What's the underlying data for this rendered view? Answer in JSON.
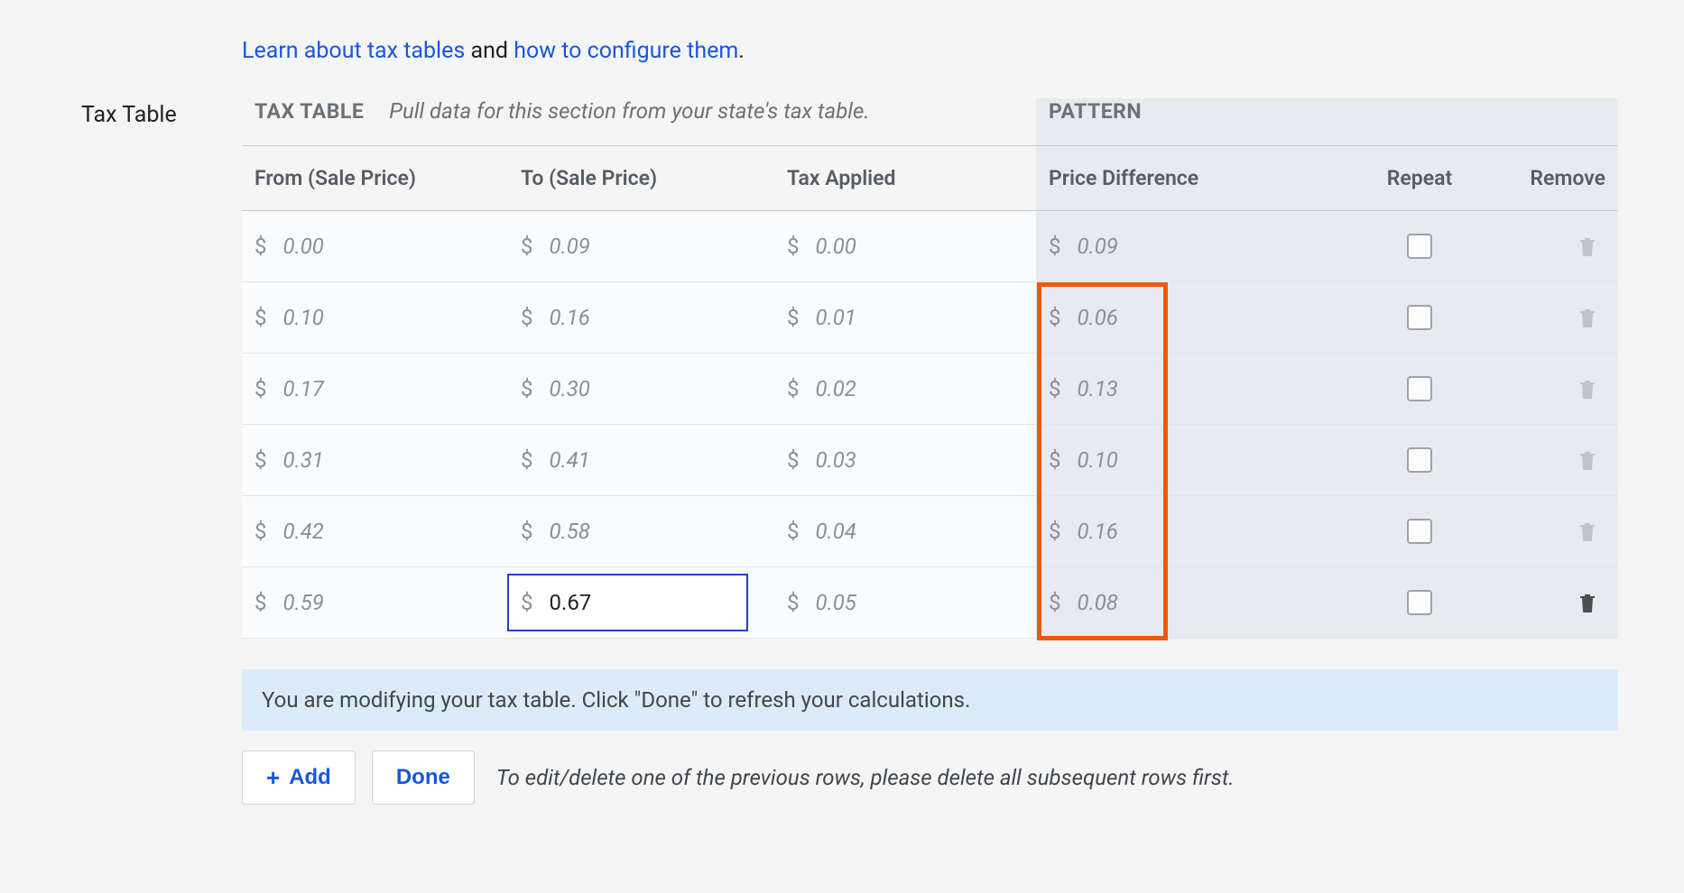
{
  "intro": {
    "link1": "Learn about tax tables",
    "middle": " and ",
    "link2": "how to configure them",
    "period": "."
  },
  "side_label": "Tax Table",
  "section": {
    "tax_table_label": "TAX TABLE",
    "tax_table_hint": "Pull data for this section from your state's tax table.",
    "pattern_label": "PATTERN"
  },
  "columns": {
    "from": "From (Sale Price)",
    "to": "To (Sale Price)",
    "tax": "Tax Applied",
    "diff": "Price Difference",
    "repeat": "Repeat",
    "remove": "Remove"
  },
  "currency_symbol": "$",
  "rows": [
    {
      "from": "0.00",
      "to": "0.09",
      "tax": "0.00",
      "diff": "0.09",
      "repeat": false,
      "editable_trash": false,
      "to_focused": false
    },
    {
      "from": "0.10",
      "to": "0.16",
      "tax": "0.01",
      "diff": "0.06",
      "repeat": false,
      "editable_trash": false,
      "to_focused": false
    },
    {
      "from": "0.17",
      "to": "0.30",
      "tax": "0.02",
      "diff": "0.13",
      "repeat": false,
      "editable_trash": false,
      "to_focused": false
    },
    {
      "from": "0.31",
      "to": "0.41",
      "tax": "0.03",
      "diff": "0.10",
      "repeat": false,
      "editable_trash": false,
      "to_focused": false
    },
    {
      "from": "0.42",
      "to": "0.58",
      "tax": "0.04",
      "diff": "0.16",
      "repeat": false,
      "editable_trash": false,
      "to_focused": false
    },
    {
      "from": "0.59",
      "to": "0.67",
      "tax": "0.05",
      "diff": "0.08",
      "repeat": false,
      "editable_trash": true,
      "to_focused": true
    }
  ],
  "notice": "You are modifying your tax table. Click \"Done\" to refresh your calculations.",
  "buttons": {
    "add": "Add",
    "done": "Done"
  },
  "footer_hint": "To edit/delete one of the previous rows, please delete all subsequent rows first."
}
